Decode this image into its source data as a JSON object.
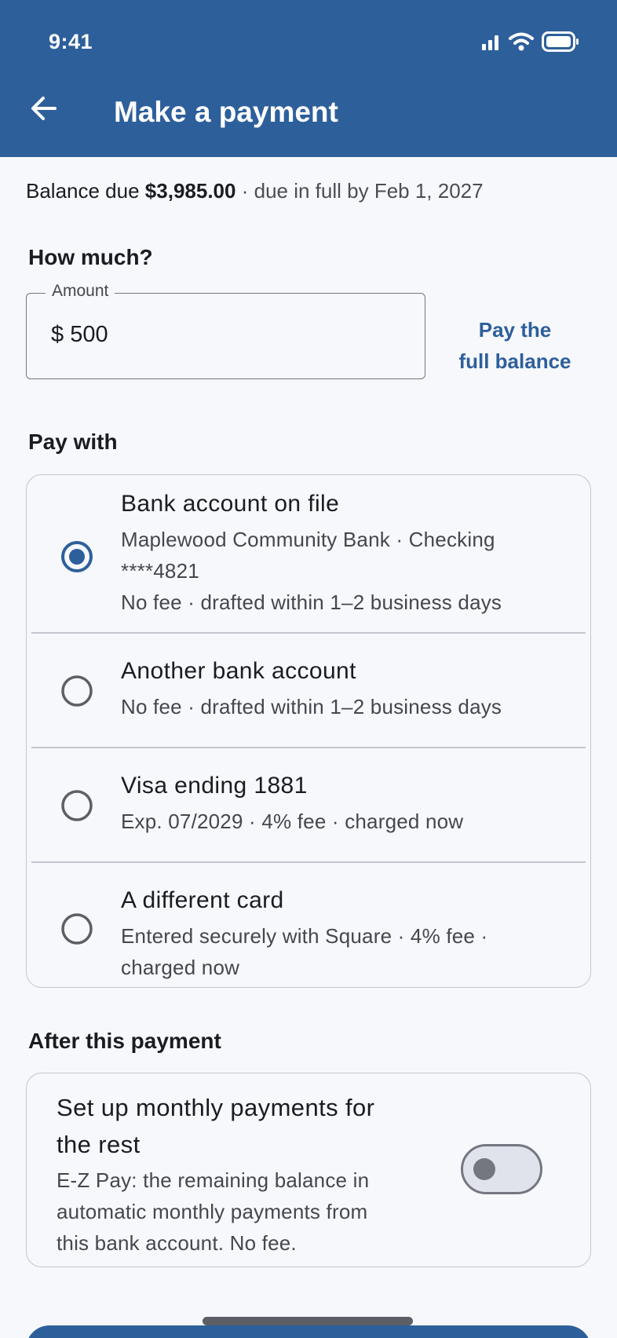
{
  "status_bar": {
    "time": "9:41"
  },
  "header": {
    "title": "Make a payment"
  },
  "balance": {
    "label": "Balance due",
    "amount": "$3,985.00",
    "separator": "·",
    "due_text": "due in full by Feb 1, 2027"
  },
  "amount_section": {
    "heading": "How much?",
    "field_label": "Amount",
    "currency": "$",
    "value": "500",
    "full_balance_line1": "Pay the",
    "full_balance_line2": "full balance"
  },
  "pay_with": {
    "heading": "Pay with",
    "selected_index": 0,
    "options": [
      {
        "title": "Bank account on file",
        "sub1": "Maplewood Community Bank · Checking",
        "sub2": "****4821",
        "sub3": "No fee · drafted within 1–2 business days"
      },
      {
        "title": "Another bank account",
        "sub1": "No fee · drafted within 1–2 business days"
      },
      {
        "title": "Visa ending 1881",
        "sub1": "Exp. 07/2029 · 4% fee · charged now"
      },
      {
        "title": "A different card",
        "sub1": "Entered securely with Square · 4% fee ·",
        "sub2": "charged now"
      }
    ]
  },
  "after_payment": {
    "heading": "After this payment",
    "title_line1": "Set up monthly payments for",
    "title_line2": "the rest",
    "desc_line1": "E-Z Pay: the remaining balance in",
    "desc_line2": "automatic monthly payments from",
    "desc_line3": "this bank account. No fee.",
    "toggle_on": false
  },
  "colors": {
    "primary": "#2d5f9b",
    "background": "#f6f8fc",
    "outline": "#c4c6cf",
    "text_secondary": "#44474e"
  }
}
